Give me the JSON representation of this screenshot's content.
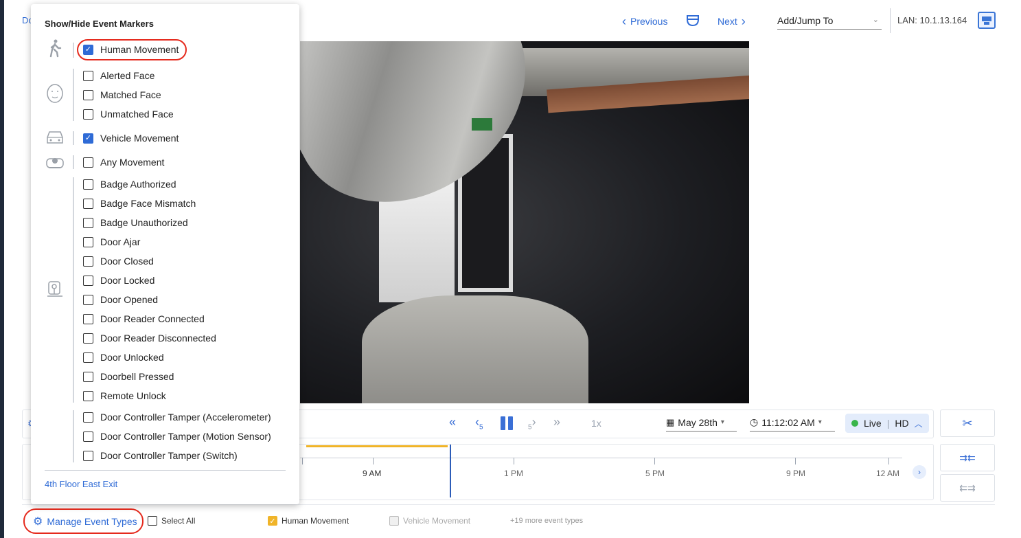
{
  "breadcrumb": {
    "text": "Do"
  },
  "header": {
    "previous_label": "Previous",
    "next_label": "Next",
    "jump_label": "Add/Jump To",
    "lan_label": "LAN: 10.1.13.164"
  },
  "playback": {
    "speed": "1x",
    "rewind5": "5",
    "forward5": "5",
    "date": "May 28th",
    "time": "11:12:02 AM",
    "live": "Live",
    "quality": "HD"
  },
  "timeline": {
    "labels": [
      "9 AM",
      "1 PM",
      "5 PM",
      "9 PM",
      "12 AM"
    ]
  },
  "filters": {
    "manage_label": "Manage Event Types",
    "select_all": "Select All",
    "human": "Human Movement",
    "vehicle": "Vehicle Movement",
    "more": "+19 more event types",
    "accent": "#f0b429"
  },
  "panel": {
    "title": "Show/Hide Event Markers",
    "camera_link": "4th Floor East Exit",
    "items": [
      {
        "label": "Human Movement",
        "checked": true
      },
      {
        "label": "Alerted Face",
        "checked": false
      },
      {
        "label": "Matched Face",
        "checked": false
      },
      {
        "label": "Unmatched Face",
        "checked": false
      },
      {
        "label": "Vehicle Movement",
        "checked": true
      },
      {
        "label": "Any Movement",
        "checked": false
      },
      {
        "label": "Badge Authorized",
        "checked": false
      },
      {
        "label": "Badge Face Mismatch",
        "checked": false
      },
      {
        "label": "Badge Unauthorized",
        "checked": false
      },
      {
        "label": "Door Ajar",
        "checked": false
      },
      {
        "label": "Door Closed",
        "checked": false
      },
      {
        "label": "Door Locked",
        "checked": false
      },
      {
        "label": "Door Opened",
        "checked": false
      },
      {
        "label": "Door Reader Connected",
        "checked": false
      },
      {
        "label": "Door Reader Disconnected",
        "checked": false
      },
      {
        "label": "Door Unlocked",
        "checked": false
      },
      {
        "label": "Doorbell Pressed",
        "checked": false
      },
      {
        "label": "Remote Unlock",
        "checked": false
      },
      {
        "label": "Door Controller Tamper (Accelerometer)",
        "checked": false
      },
      {
        "label": "Door Controller Tamper (Motion Sensor)",
        "checked": false
      },
      {
        "label": "Door Controller Tamper (Switch)",
        "checked": false
      }
    ]
  },
  "colors": {
    "accent": "#2f6bd6",
    "highlight": "#e5291c",
    "live": "#39b54a"
  }
}
